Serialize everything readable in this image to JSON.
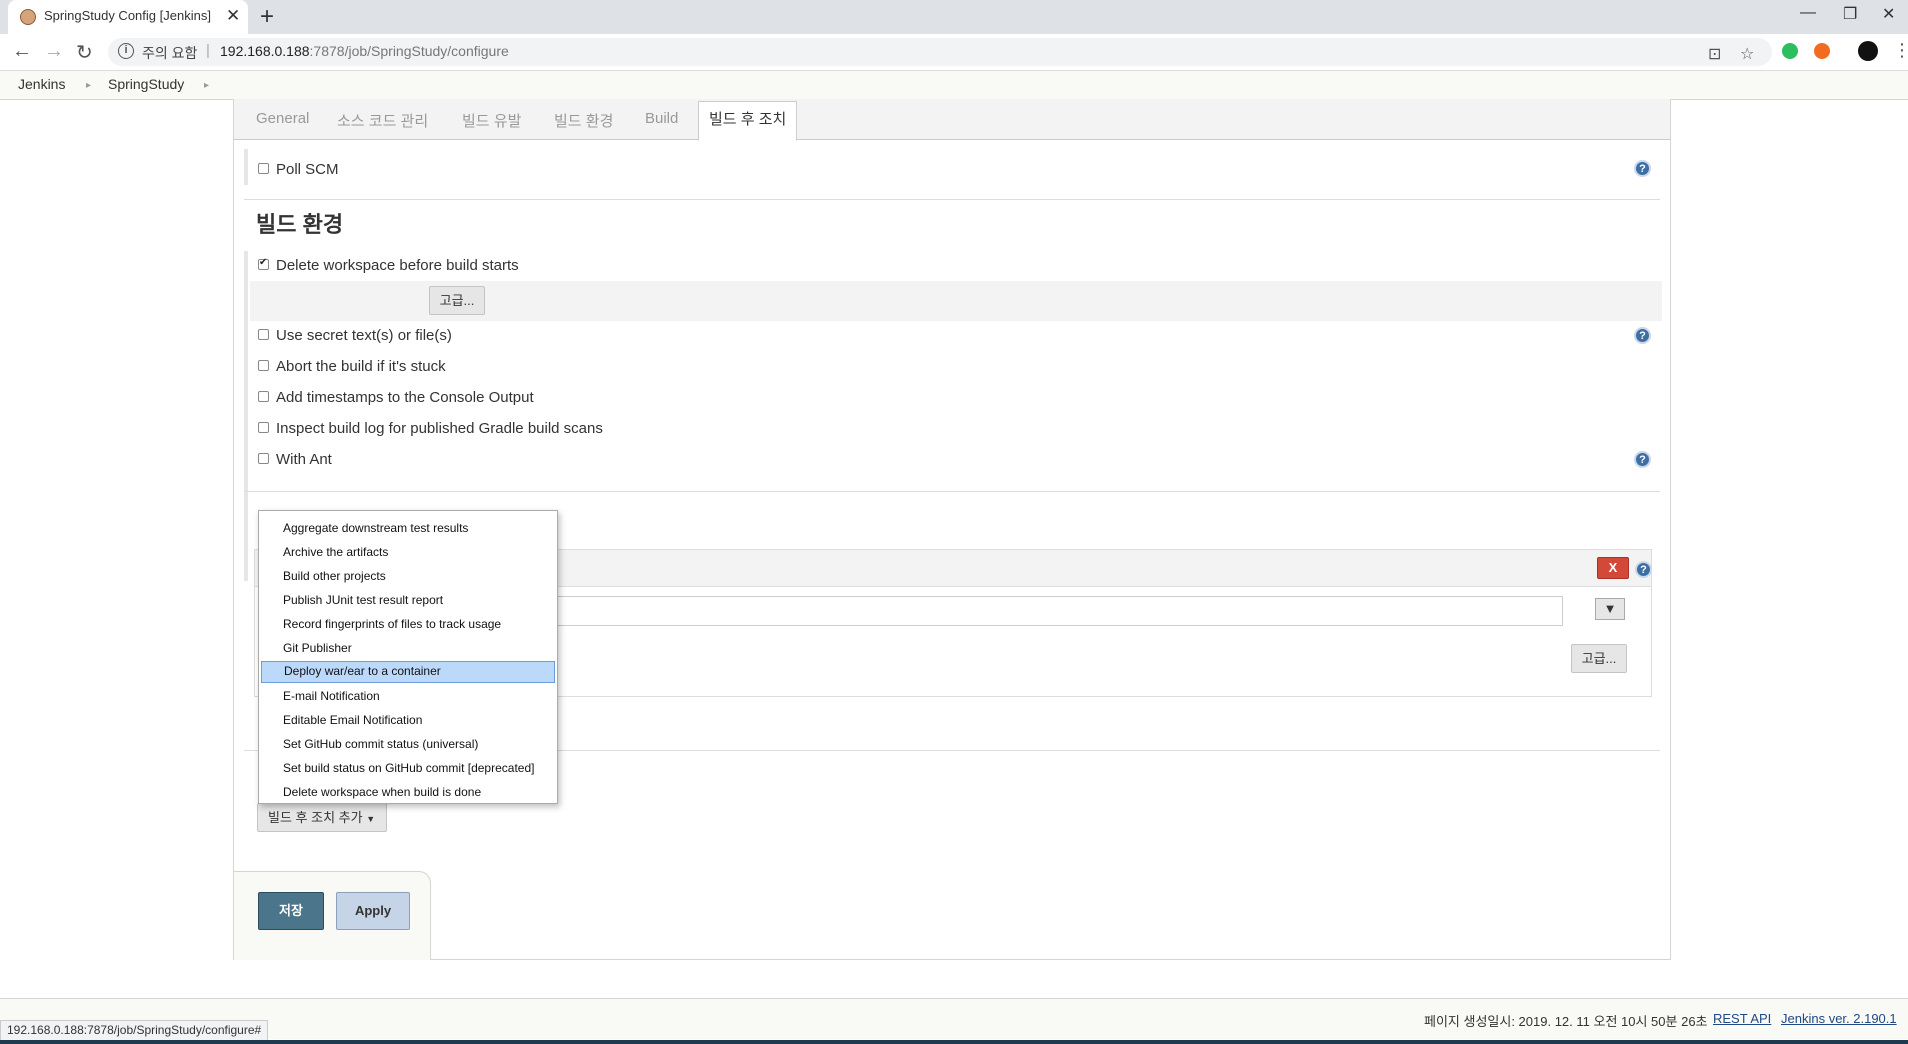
{
  "browser": {
    "tab_title": "SpringStudy Config [Jenkins]",
    "new_tab": "+",
    "address": {
      "warning": "주의 요함",
      "host": "192.168.0.188",
      "path": ":7878/job/SpringStudy/configure"
    }
  },
  "breadcrumb": [
    "Jenkins",
    "SpringStudy"
  ],
  "tabs": [
    "General",
    "소스 코드 관리",
    "빌드 유발",
    "빌드 환경",
    "Build",
    "빌드 후 조치"
  ],
  "trigger": {
    "poll_scm": "Poll SCM"
  },
  "build_env": {
    "title": "빌드 환경",
    "delete_workspace": "Delete workspace before build starts",
    "advanced": "고급...",
    "options": [
      "Use secret text(s) or file(s)",
      "Abort the build if it's stuck",
      "Add timestamps to the Console Output",
      "Inspect build log for published Gradle build scans",
      "With Ant"
    ]
  },
  "publisher": {
    "delete": "X",
    "advanced": "고급...",
    "dropdown_arrow": "▼"
  },
  "menu": {
    "items": [
      "Aggregate downstream test results",
      "Archive the artifacts",
      "Build other projects",
      "Publish JUnit test result report",
      "Record fingerprints of files to track usage",
      "Git Publisher",
      "Deploy war/ear to a container",
      "E-mail Notification",
      "Editable Email Notification",
      "Set GitHub commit status (universal)",
      "Set build status on GitHub commit [deprecated]",
      "Delete workspace when build is done"
    ],
    "selected_index": 6
  },
  "add_post_build": "빌드 후 조치 추가",
  "save": "저장",
  "apply": "Apply",
  "footer": {
    "generated": "페이지 생성일시: 2019. 12. 11 오전 10시 50분 26초",
    "rest_api": "REST API",
    "version": "Jenkins ver. 2.190.1"
  },
  "status_url": "192.168.0.188:7878/job/SpringStudy/configure#",
  "colors": {
    "save": "#4b758b",
    "apply": "#c5d4e6",
    "delete": "#d24939",
    "help": "#3d6fa5",
    "menu_selected": "#bcd9fb"
  }
}
